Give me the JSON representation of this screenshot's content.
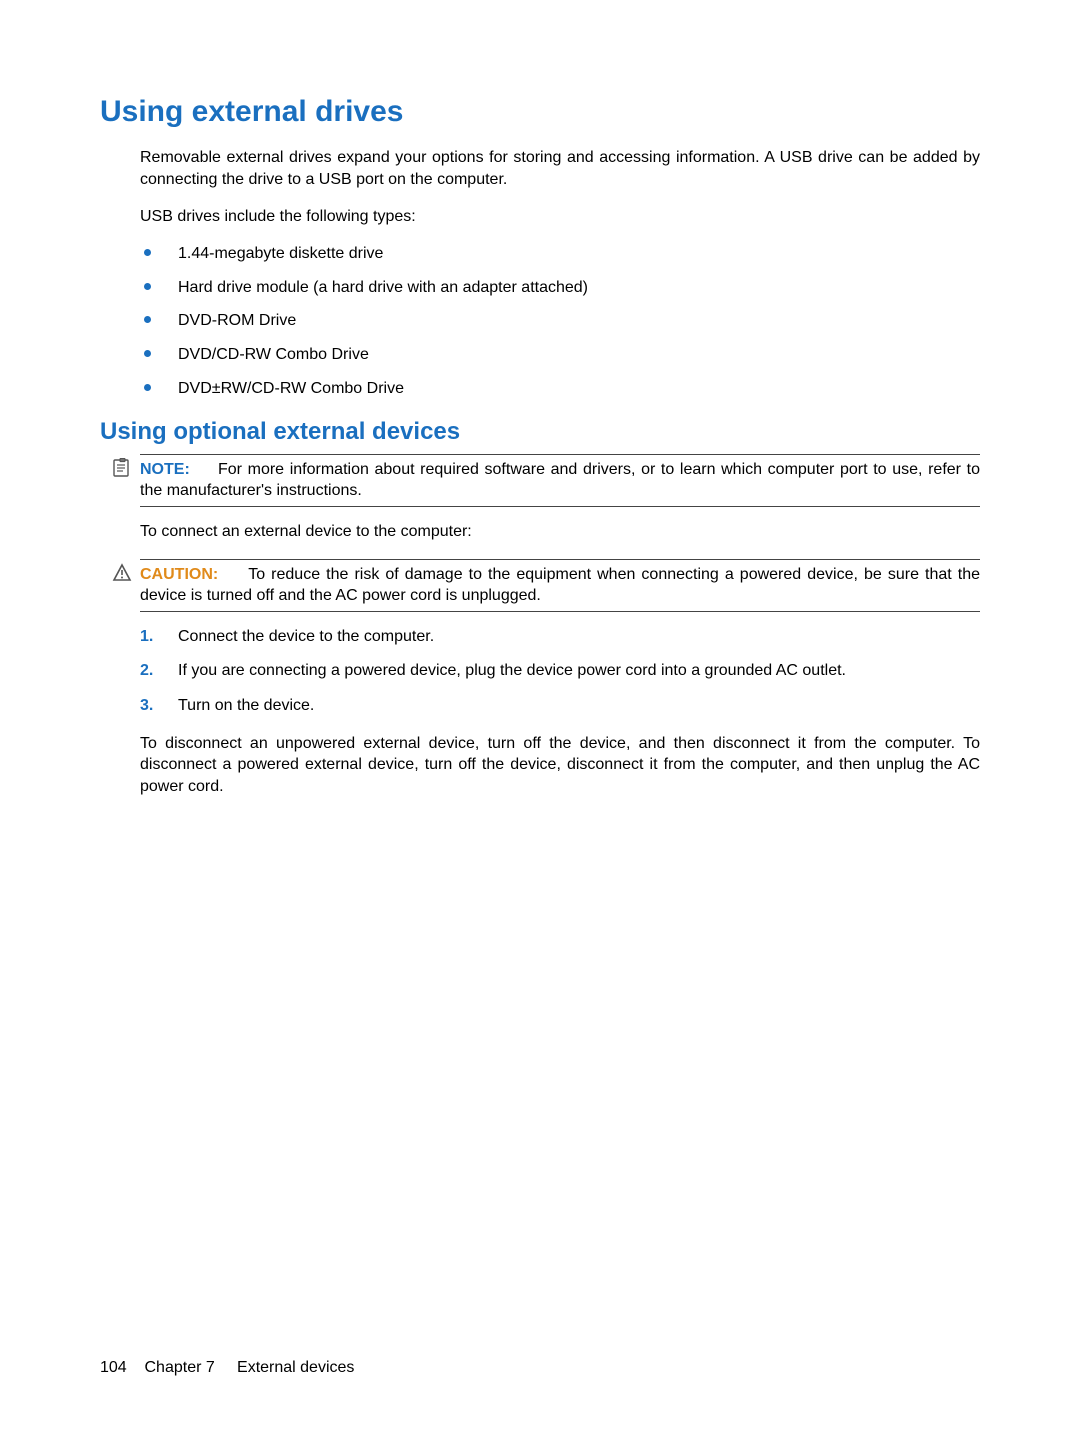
{
  "main": {
    "title": "Using external drives",
    "intro_p1": "Removable external drives expand your options for storing and accessing information. A USB drive can be added by connecting the drive to a USB port on the computer.",
    "intro_p2": "USB drives include the following types:",
    "bullets": [
      "1.44-megabyte diskette drive",
      "Hard drive module (a hard drive with an adapter attached)",
      "DVD-ROM Drive",
      "DVD/CD-RW Combo Drive",
      "DVD±RW/CD-RW Combo Drive"
    ]
  },
  "section2": {
    "title": "Using optional external devices",
    "note_label": "NOTE:",
    "note_text": "For more information about required software and drivers, or to learn which computer port to use, refer to the manufacturer's instructions.",
    "connect_intro": "To connect an external device to the computer:",
    "caution_label": "CAUTION:",
    "caution_text": "To reduce the risk of damage to the equipment when connecting a powered device, be sure that the device is turned off and the AC power cord is unplugged.",
    "steps": [
      {
        "num": "1.",
        "text": "Connect the device to the computer."
      },
      {
        "num": "2.",
        "text": "If you are connecting a powered device, plug the device power cord into a grounded AC outlet."
      },
      {
        "num": "3.",
        "text": "Turn on the device."
      }
    ],
    "disconnect_p": "To disconnect an unpowered external device, turn off the device, and then disconnect it from the computer. To disconnect a powered external device, turn off the device, disconnect it from the computer, and then unplug the AC power cord."
  },
  "footer": {
    "page_num": "104",
    "chapter": "Chapter 7",
    "chapter_title": "External devices"
  }
}
